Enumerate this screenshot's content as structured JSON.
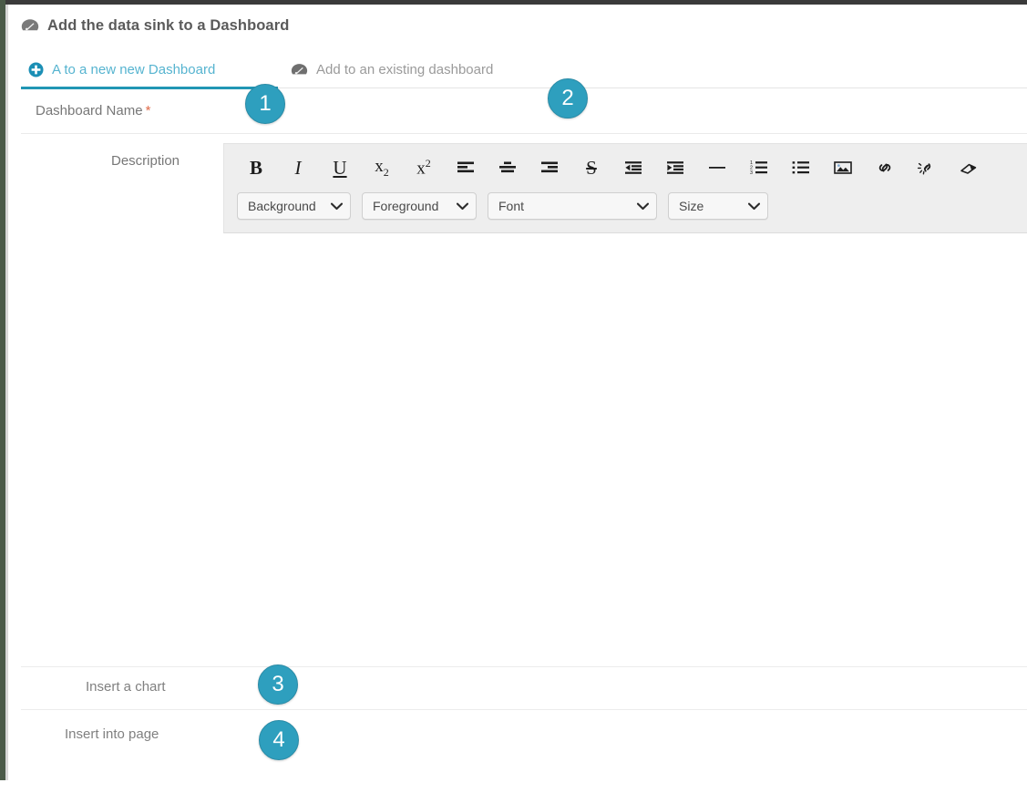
{
  "window": {
    "accent_color": "#2196b4",
    "badge_color": "#2e9fbe",
    "toolbar_bg": "#eeeeee",
    "required_star_color": "#e06b4a"
  },
  "header": {
    "icon": "dashboard-gauge-icon",
    "title": "Add the data sink to a Dashboard"
  },
  "tabs": [
    {
      "id": "new-dashboard",
      "icon": "plus-circle-icon",
      "label": "A to a new new Dashboard",
      "active": true
    },
    {
      "id": "existing-dashboard",
      "icon": "dashboard-gauge-icon",
      "label": "Add to an existing dashboard",
      "active": false
    }
  ],
  "form": {
    "dashboard_name": {
      "label": "Dashboard Name",
      "required_marker": "*",
      "value": "",
      "placeholder": ""
    },
    "description": {
      "label": "Description",
      "value": "",
      "placeholder": ""
    },
    "insert_chart": {
      "label": "Insert a chart"
    },
    "insert_page": {
      "label": "Insert into page"
    }
  },
  "editor_toolbar": {
    "buttons": [
      {
        "name": "bold-icon",
        "glyph": "B",
        "style": "bold"
      },
      {
        "name": "italic-icon",
        "glyph": "I",
        "style": "ital"
      },
      {
        "name": "underline-icon",
        "glyph": "U",
        "style": "und"
      },
      {
        "name": "subscript-icon",
        "glyph": "x",
        "style": "sub"
      },
      {
        "name": "superscript-icon",
        "glyph": "x",
        "style": "sup"
      },
      {
        "name": "align-left-icon",
        "glyph": "",
        "style": "svg"
      },
      {
        "name": "align-center-icon",
        "glyph": "",
        "style": "svg"
      },
      {
        "name": "align-right-icon",
        "glyph": "",
        "style": "svg"
      },
      {
        "name": "strikethrough-icon",
        "glyph": "S",
        "style": "strike"
      },
      {
        "name": "outdent-icon",
        "glyph": "",
        "style": "svg"
      },
      {
        "name": "indent-icon",
        "glyph": "",
        "style": "svg"
      },
      {
        "name": "horizontal-rule-icon",
        "glyph": "",
        "style": "svg"
      },
      {
        "name": "ordered-list-icon",
        "glyph": "",
        "style": "svg"
      },
      {
        "name": "unordered-list-icon",
        "glyph": "",
        "style": "svg"
      },
      {
        "name": "insert-image-icon",
        "glyph": "",
        "style": "svg"
      },
      {
        "name": "insert-link-icon",
        "glyph": "",
        "style": "svg"
      },
      {
        "name": "unlink-icon",
        "glyph": "",
        "style": "svg"
      },
      {
        "name": "eraser-icon",
        "glyph": "",
        "style": "svg"
      }
    ],
    "selects": [
      {
        "name": "background-color-select",
        "label": "Background",
        "caret": "⌄"
      },
      {
        "name": "foreground-color-select",
        "label": "Foreground",
        "caret": "⌄"
      },
      {
        "name": "font-family-select",
        "label": "Font",
        "caret": "⌄"
      },
      {
        "name": "font-size-select",
        "label": "Size",
        "caret": "⌄"
      }
    ]
  },
  "callouts": [
    {
      "id": "callout-1",
      "number": "1"
    },
    {
      "id": "callout-2",
      "number": "2"
    },
    {
      "id": "callout-3",
      "number": "3"
    },
    {
      "id": "callout-4",
      "number": "4"
    }
  ]
}
